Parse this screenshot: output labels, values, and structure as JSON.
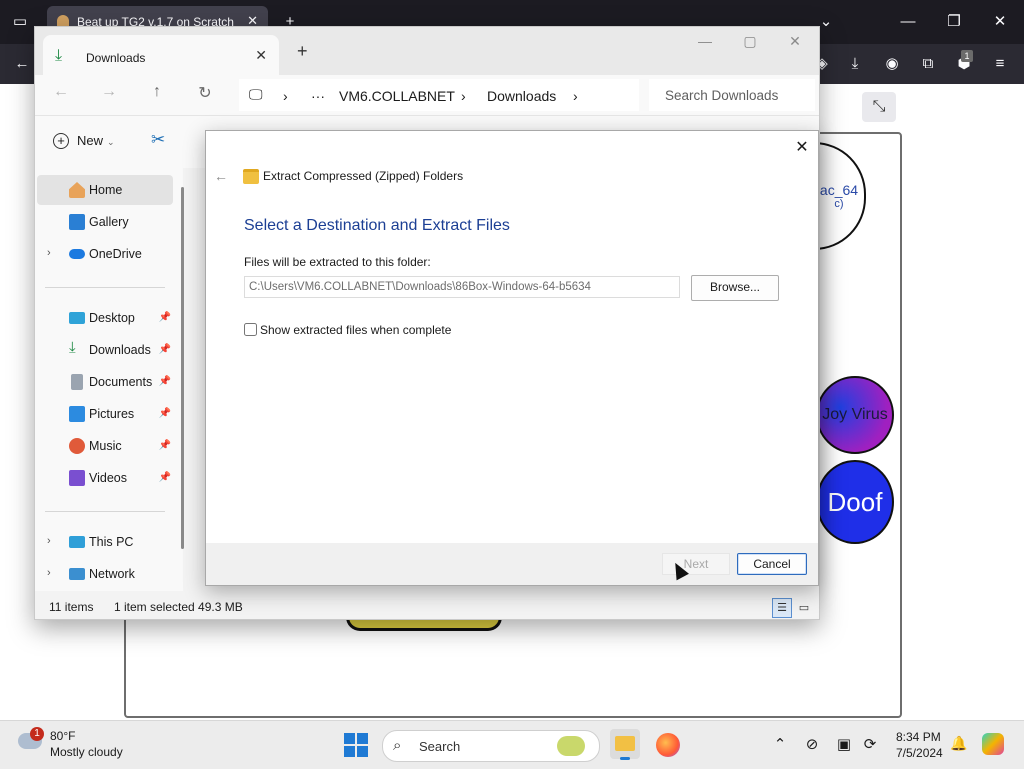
{
  "browser": {
    "tab_title": "Beat up TG2 v.1.7 on Scratch",
    "new_tab": "+",
    "extension_badge": "1"
  },
  "stage": {
    "sprite_top_text": "ac_64",
    "sprite_top_sub": "c)",
    "sprite_mid_text": "Joy Virus",
    "sprite_bottom_text": "Doof"
  },
  "explorer": {
    "tab_title": "Downloads",
    "address": {
      "ellipsis": "···",
      "segments": [
        "VM6.COLLABNET",
        "Downloads"
      ]
    },
    "search_placeholder": "Search Downloads",
    "toolbar": {
      "new_label": "New"
    },
    "nav": {
      "items": [
        {
          "label": "Home"
        },
        {
          "label": "Gallery"
        },
        {
          "label": "OneDrive"
        },
        {
          "label": "Desktop"
        },
        {
          "label": "Downloads"
        },
        {
          "label": "Documents"
        },
        {
          "label": "Pictures"
        },
        {
          "label": "Music"
        },
        {
          "label": "Videos"
        },
        {
          "label": "This PC"
        },
        {
          "label": "Network"
        }
      ]
    },
    "status": {
      "items_count": "11 items",
      "selection": "1 item selected  49.3 MB"
    }
  },
  "dialog": {
    "title": "Extract Compressed (Zipped) Folders",
    "heading": "Select a Destination and Extract Files",
    "dest_label": "Files will be extracted to this folder:",
    "dest_value": "C:\\Users\\VM6.COLLABNET\\Downloads\\86Box-Windows-64-b5634",
    "browse_label": "Browse...",
    "show_label": "Show extracted files when complete",
    "show_checked": false,
    "next_label": "Next",
    "cancel_label": "Cancel"
  },
  "taskbar": {
    "weather_badge": "1",
    "weather_temp": "80°F",
    "weather_desc": "Mostly cloudy",
    "search_label": "Search",
    "time": "8:34 PM",
    "date": "7/5/2024"
  },
  "colors": {
    "accent": "#1f7ad4",
    "dialog_heading": "#1c3f94",
    "cancel_border": "#2e6bbd"
  }
}
